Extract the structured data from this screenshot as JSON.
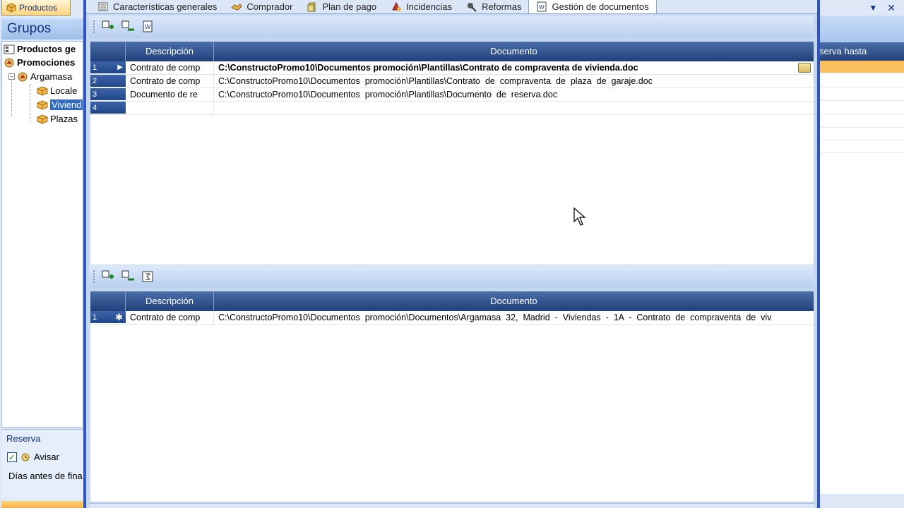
{
  "left_panel": {
    "tab_label": "Productos",
    "grupos_title": "Grupos",
    "tree": [
      {
        "label": "Productos ge",
        "bold": true
      },
      {
        "label": "Promociones",
        "bold": true
      },
      {
        "label": "Argamasa",
        "bold": false
      },
      {
        "label": "Locale",
        "bold": false
      },
      {
        "label": "Viviend",
        "bold": false,
        "selected": true
      },
      {
        "label": "Plazas",
        "bold": false
      }
    ],
    "reserva": {
      "title": "Reserva",
      "avisar_label": "Avisar",
      "avisar_checked": true,
      "dias_label": "Días antes de fina"
    }
  },
  "right_panel": {
    "column_header": "serva hasta"
  },
  "tabs": [
    {
      "label": "Características generales",
      "icon": "list-icon"
    },
    {
      "label": "Comprador",
      "icon": "handshake-icon"
    },
    {
      "label": "Plan de pago",
      "icon": "money-icon"
    },
    {
      "label": "Incidencias",
      "icon": "warning-icon"
    },
    {
      "label": "Reformas",
      "icon": "tools-icon"
    },
    {
      "label": "Gestión de documentos",
      "icon": "word-document-icon",
      "active": true
    }
  ],
  "top_grid": {
    "headers": {
      "descripcion": "Descripción",
      "documento": "Documento"
    },
    "rows": [
      {
        "num": "1",
        "descripcion": "Contrato de comp",
        "documento": "C:\\ConstructoPromo10\\Documentos promoción\\Plantillas\\Contrato de compraventa de vivienda.doc",
        "current": true,
        "bold": true
      },
      {
        "num": "2",
        "descripcion": "Contrato de comp",
        "documento": "C:\\ConstructoPromo10\\Documentos  promoción\\Plantillas\\Contrato  de  compraventa  de  plaza  de  garaje.doc"
      },
      {
        "num": "3",
        "descripcion": "Documento de re",
        "documento": "C:\\ConstructoPromo10\\Documentos  promoción\\Plantillas\\Documento  de  reserva.doc"
      },
      {
        "num": "4",
        "descripcion": "",
        "documento": ""
      }
    ]
  },
  "bottom_grid": {
    "headers": {
      "descripcion": "Descripción",
      "documento": "Documento"
    },
    "rows": [
      {
        "num": "1",
        "marker": "✱",
        "descripcion": "Contrato de comp",
        "documento": "C:\\ConstructoPromo10\\Documentos  promoción\\Documentos\\Argamasa  32,  Madrid  -  Viviendas  -  1A  -  Contrato  de  compraventa  de  viv"
      }
    ]
  },
  "colors": {
    "frame_blue": "#2d55c4",
    "header_blue": "#20407b",
    "selection_orange": "#fbbf5c"
  }
}
